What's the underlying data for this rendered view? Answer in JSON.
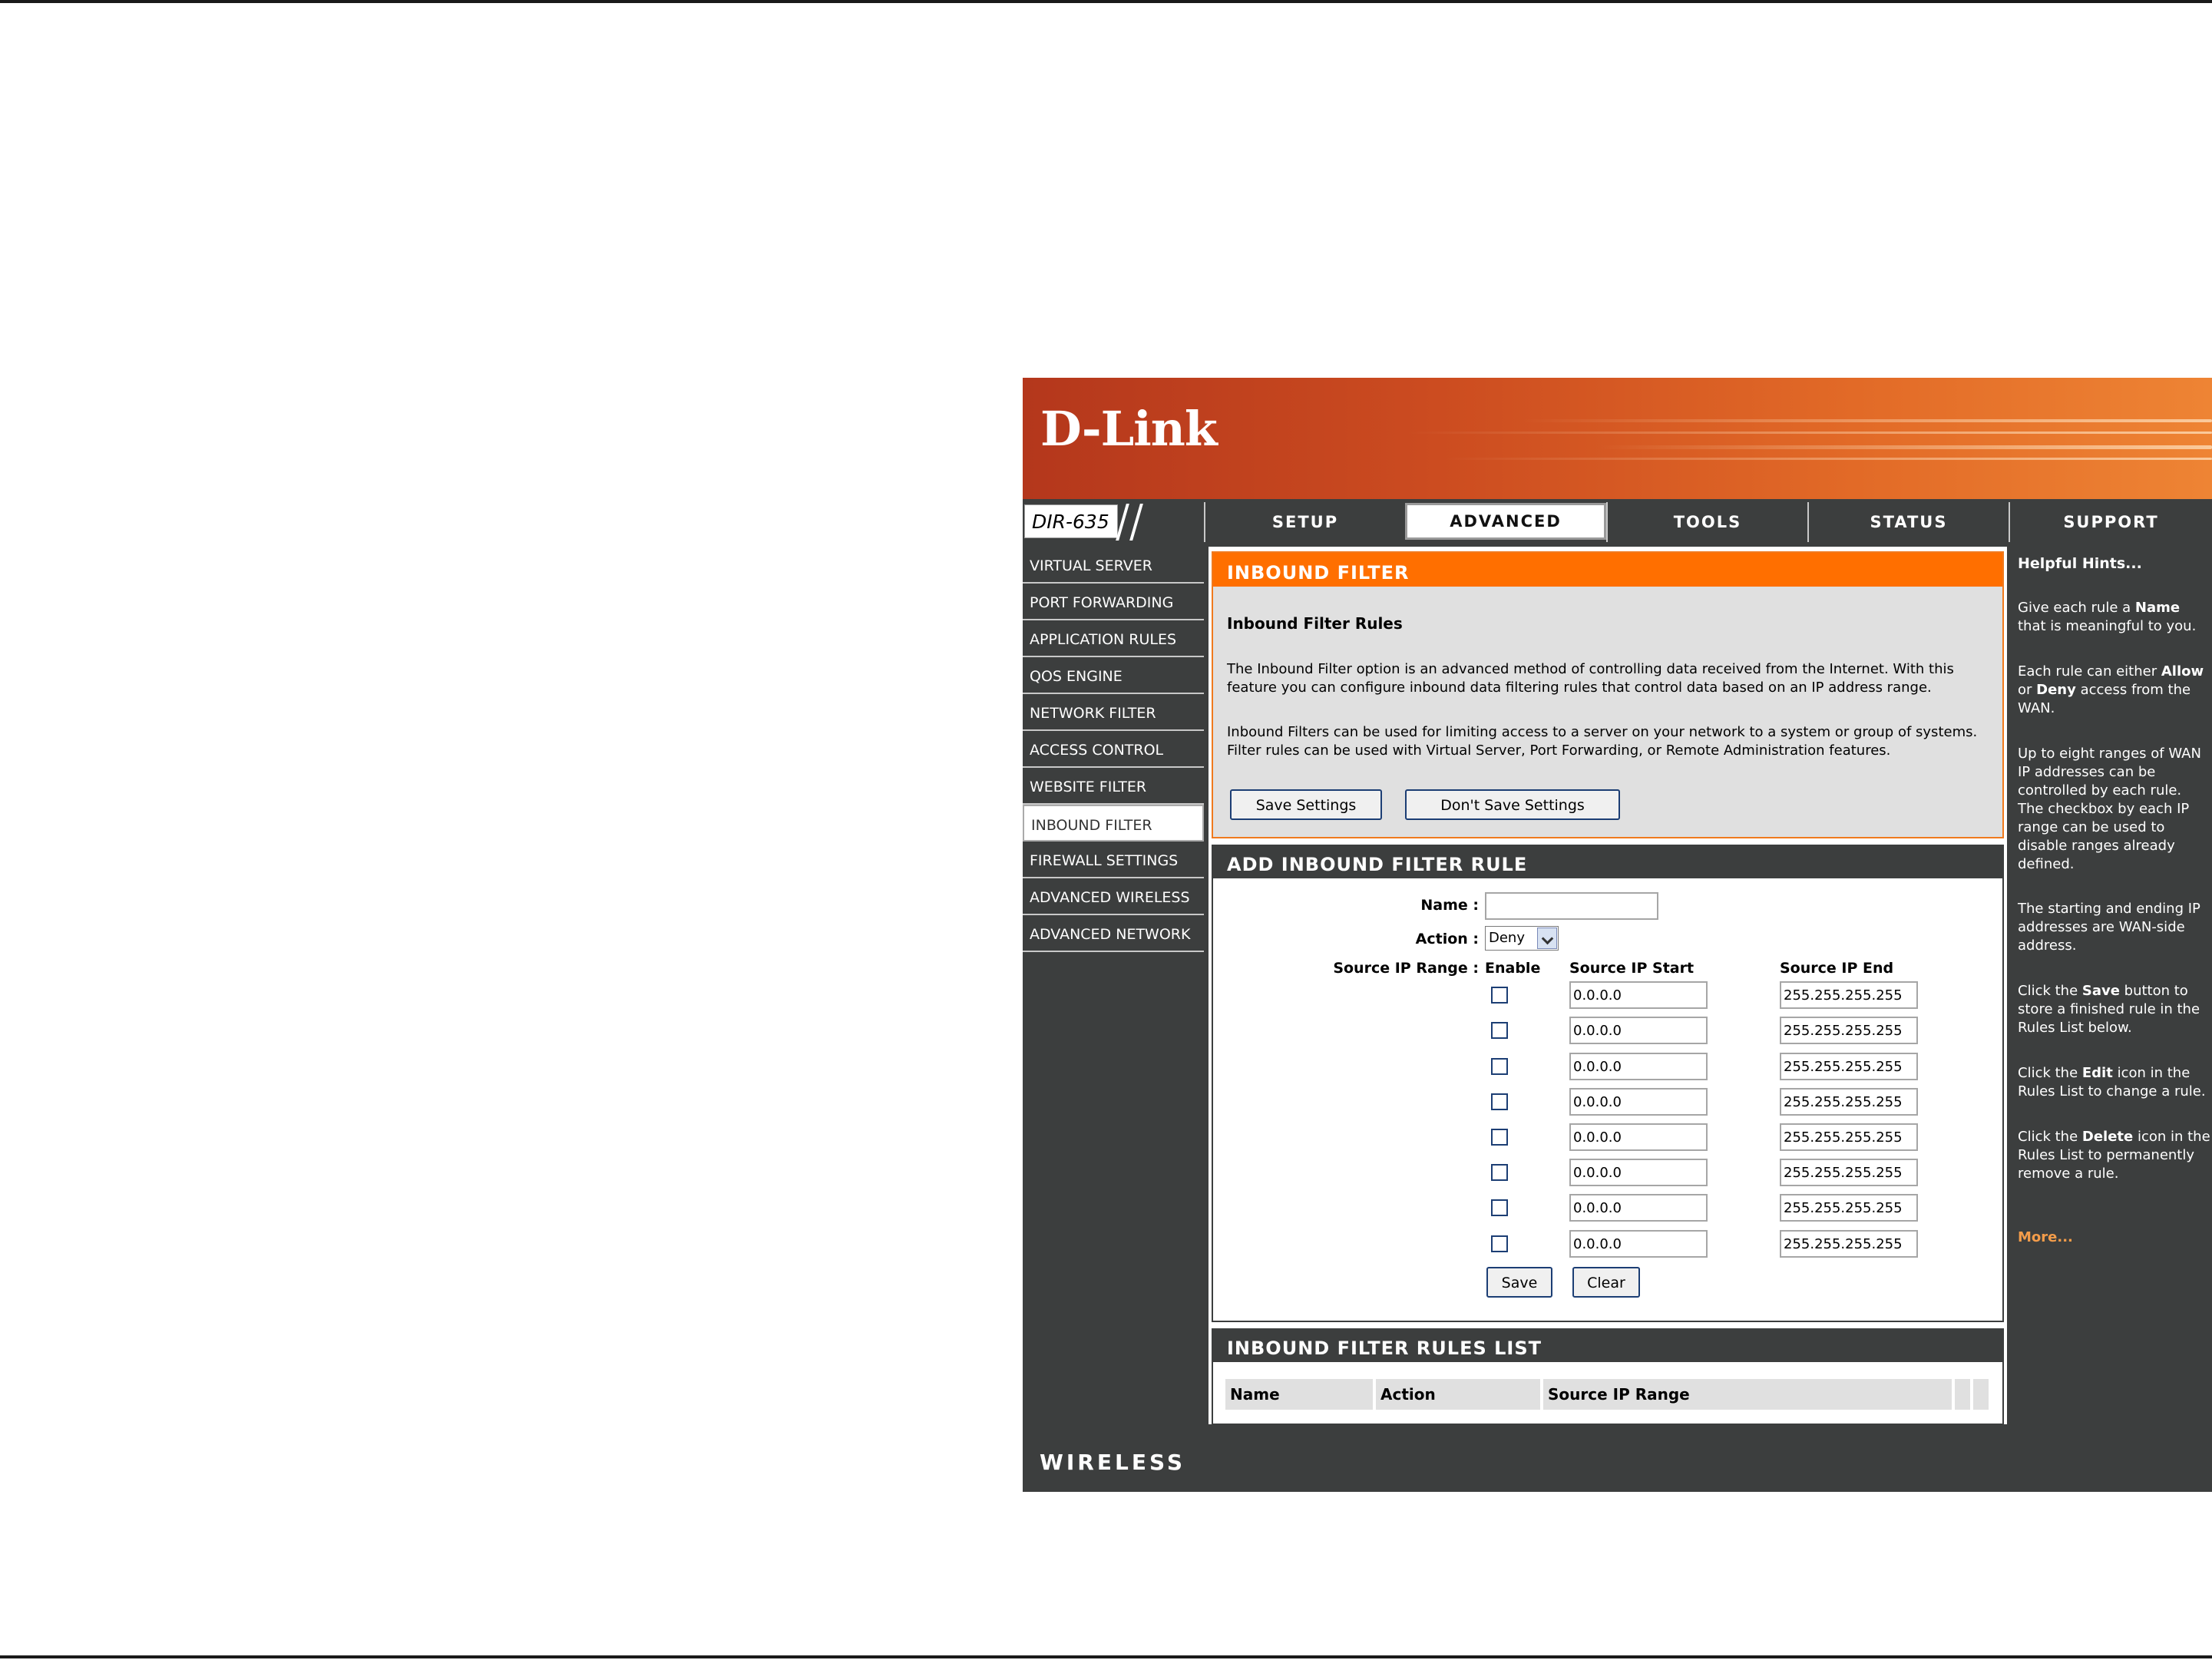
{
  "brand": {
    "logo": "D-Link",
    "model": "DIR-635"
  },
  "tabs": [
    {
      "label": "SETUP"
    },
    {
      "label": "ADVANCED"
    },
    {
      "label": "TOOLS"
    },
    {
      "label": "STATUS"
    },
    {
      "label": "SUPPORT"
    }
  ],
  "active_tab": "ADVANCED",
  "sidebar": {
    "items": [
      {
        "label": "VIRTUAL SERVER"
      },
      {
        "label": "PORT FORWARDING"
      },
      {
        "label": "APPLICATION RULES"
      },
      {
        "label": "QOS ENGINE"
      },
      {
        "label": "NETWORK FILTER"
      },
      {
        "label": "ACCESS CONTROL"
      },
      {
        "label": "WEBSITE FILTER"
      },
      {
        "label": "INBOUND FILTER"
      },
      {
        "label": "FIREWALL SETTINGS"
      },
      {
        "label": "ADVANCED WIRELESS"
      },
      {
        "label": "ADVANCED NETWORK"
      }
    ],
    "active": "INBOUND FILTER"
  },
  "inbound_filter": {
    "title": "INBOUND FILTER",
    "subtitle": "Inbound Filter Rules",
    "para1_line1": "The Inbound Filter option is an advanced method of controlling data received from the Internet. With this",
    "para1_line2": "feature you can configure inbound data filtering rules that control data based on an IP address range.",
    "para2_line1": "Inbound Filters can be used for limiting access to a server on your network to a system or group of systems.",
    "para2_line2": "Filter rules can be used with Virtual Server, Port Forwarding, or Remote Administration features.",
    "save_label": "Save Settings",
    "dont_save_label": "Don't Save Settings"
  },
  "add_rule": {
    "title": "ADD INBOUND FILTER RULE",
    "name_label": "Name :",
    "name_value": "",
    "action_label": "Action :",
    "action_value": "Deny",
    "range_label": "Source IP Range :",
    "col_enable": "Enable",
    "col_start": "Source IP Start",
    "col_end": "Source IP End",
    "ranges": [
      {
        "enabled": false,
        "start": "0.0.0.0",
        "end": "255.255.255.255"
      },
      {
        "enabled": false,
        "start": "0.0.0.0",
        "end": "255.255.255.255"
      },
      {
        "enabled": false,
        "start": "0.0.0.0",
        "end": "255.255.255.255"
      },
      {
        "enabled": false,
        "start": "0.0.0.0",
        "end": "255.255.255.255"
      },
      {
        "enabled": false,
        "start": "0.0.0.0",
        "end": "255.255.255.255"
      },
      {
        "enabled": false,
        "start": "0.0.0.0",
        "end": "255.255.255.255"
      },
      {
        "enabled": false,
        "start": "0.0.0.0",
        "end": "255.255.255.255"
      },
      {
        "enabled": false,
        "start": "0.0.0.0",
        "end": "255.255.255.255"
      }
    ],
    "save_label": "Save",
    "clear_label": "Clear"
  },
  "rules_list": {
    "title": "INBOUND FILTER RULES LIST",
    "col_name": "Name",
    "col_action": "Action",
    "col_range": "Source IP Range"
  },
  "hints": {
    "title": "Helpful Hints...",
    "h1_a": "Give each rule a ",
    "h1_b": "Name",
    "h1_c": " that is meaningful to you.",
    "h2_a": "Each rule can either ",
    "h2_b": "Allow",
    "h2_c": " or ",
    "h2_d": "Deny",
    "h2_e": " access from the WAN.",
    "h3": "Up to eight ranges of WAN IP addresses can be controlled by each rule. The checkbox by each IP range can be used to disable ranges already defined.",
    "h4": "The starting and ending IP addresses are WAN-side address.",
    "h5_a": "Click the ",
    "h5_b": "Save",
    "h5_c": " button to store a finished rule in the Rules List below.",
    "h6_a": "Click the ",
    "h6_b": "Edit",
    "h6_c": " icon in the Rules List to change a rule.",
    "h7_a": "Click the ",
    "h7_b": "Delete",
    "h7_c": " icon in the Rules List to permanently remove a rule.",
    "more": "More..."
  },
  "footer": {
    "label": "WIRELESS"
  },
  "colors": {
    "accent": "#ff6f00",
    "dark": "#3c3e3e",
    "hint_more": "#f39c4a"
  }
}
